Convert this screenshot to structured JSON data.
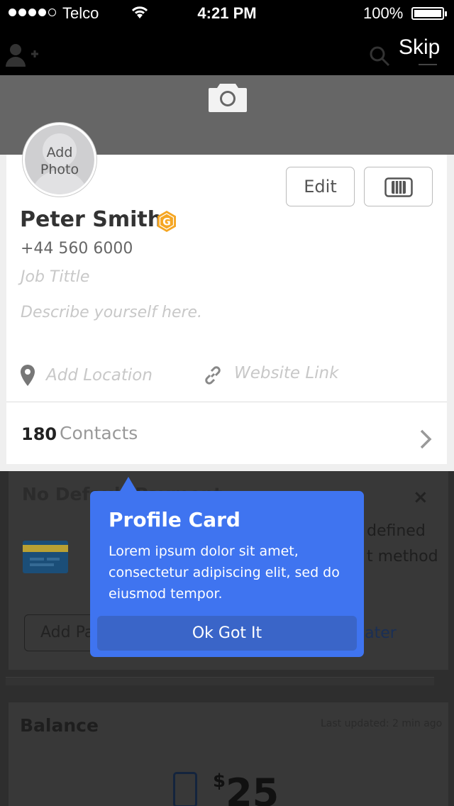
{
  "status_bar": {
    "carrier": "Telco",
    "time": "4:21 PM",
    "battery": "100%",
    "signal_bars": 4
  },
  "nav": {
    "skip_label": "Skip",
    "icons": [
      "add-user-icon",
      "search-icon"
    ]
  },
  "cover": {
    "icon": "camera-icon"
  },
  "profile": {
    "avatar_label": "Add\nPhoto",
    "name": "Peter Smith",
    "badge_icon": "gold-badge-icon",
    "badge_letter": "G",
    "phone": "+44 560 6000",
    "job_placeholder": "Job Tittle",
    "description_placeholder": "Describe yourself here.",
    "location_placeholder": "Add Location",
    "website_placeholder": "Website Link",
    "edit_label": "Edit",
    "card_button_icon": "sim-card-icon",
    "contacts_count": "180",
    "contacts_label": "Contacts"
  },
  "payment": {
    "title": "No Default Payment",
    "text_line_1": "defined",
    "text_line_2": "t method",
    "add_button": "Add Pa",
    "later_link": "later",
    "close_icon": "close-icon",
    "close_glyph": "×"
  },
  "balance": {
    "title": "Balance",
    "updated": "Last updated: 2 min ago",
    "currency": "$",
    "amount": "25"
  },
  "tooltip": {
    "title": "Profile Card",
    "body": "Lorem ipsum dolor sit amet, consectetur adipiscing elit, sed do eiusmod tempor.",
    "button": "Ok Got It"
  },
  "colors": {
    "tooltip_blue": "#3f74f0",
    "tooltip_button": "#3a65c8",
    "badge_gold": "#f5a623"
  }
}
